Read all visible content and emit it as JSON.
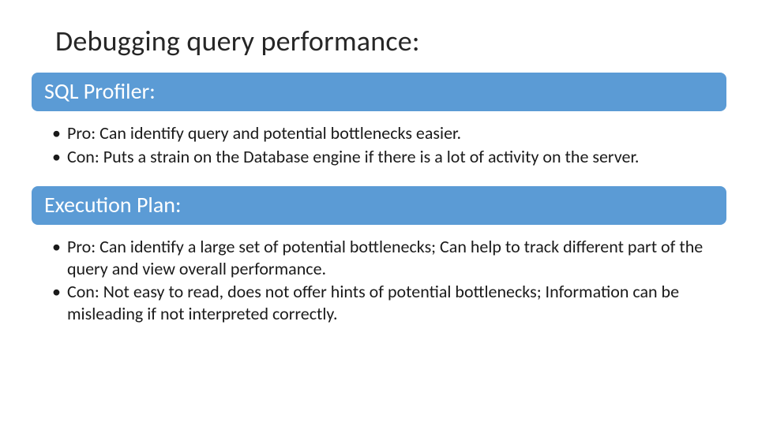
{
  "title": "Debugging query performance:",
  "sections": [
    {
      "header": "SQL Profiler:",
      "bullets": [
        "Pro: Can identify query and potential bottlenecks easier.",
        "Con: Puts a strain on the Database engine if there is a lot of activity on the server."
      ]
    },
    {
      "header": "Execution Plan:",
      "bullets": [
        "Pro: Can identify a large set of potential bottlenecks; Can help to track different part of the query and view overall performance.",
        "Con: Not easy to read, does not offer hints of potential bottlenecks; Information can be misleading if not interpreted correctly."
      ]
    }
  ],
  "colors": {
    "accent": "#5b9bd5"
  }
}
